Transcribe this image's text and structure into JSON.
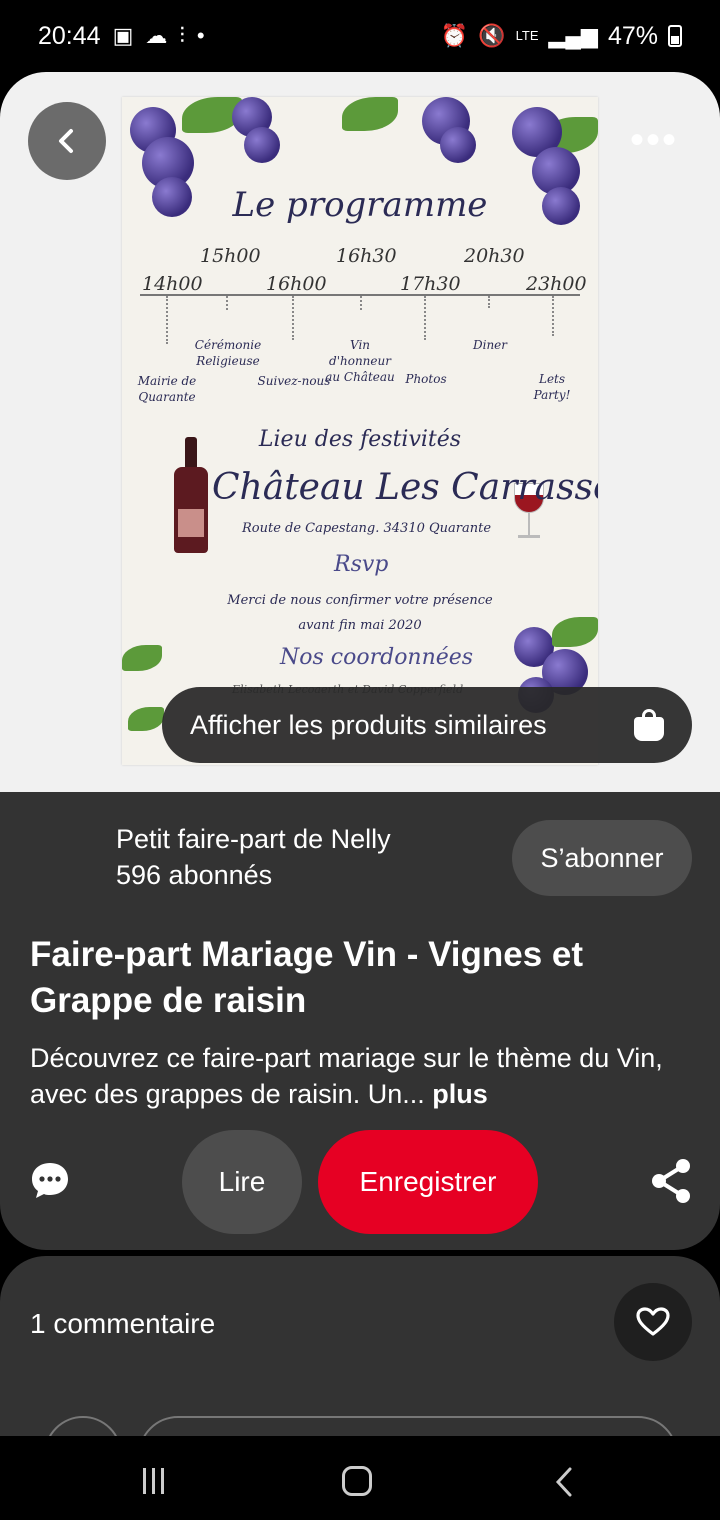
{
  "status_bar": {
    "time": "20:44",
    "network": "LTE",
    "battery": "47%"
  },
  "invitation": {
    "title": "Le programme",
    "times": [
      "14h00",
      "15h00",
      "16h00",
      "16h30",
      "17h30",
      "20h30",
      "23h00"
    ],
    "events": [
      "Mairie de Quarante",
      "Cérémonie Religieuse",
      "Suivez-nous",
      "Vin d'honneur au Château",
      "Photos",
      "Diner",
      "Lets Party!"
    ],
    "lieu_title": "Lieu des festivités",
    "venue": "Château Les Carrasses",
    "address": "Route de Capestang. 34310 Quarante",
    "rsvp": "Rsvp",
    "rsvp_text_1": "Merci de nous confirmer votre présence",
    "rsvp_text_2": "avant fin mai 2020",
    "coords_title": "Nos coordonnées",
    "names": "Elisabeth Lecoaerth et David Copperfield"
  },
  "similar_products_label": "Afficher les produits similaires",
  "creator": {
    "name": "Petit faire-part de Nelly",
    "followers": "596 abonnés",
    "follow_label": "S’abonner"
  },
  "pin": {
    "title": "Faire-part Mariage Vin - Vignes et Grappe de raisin",
    "description": "Découvrez ce faire-part mariage sur le thème du Vin, avec des grappes de raisin. Un...",
    "more_label": "plus"
  },
  "actions": {
    "read_label": "Lire",
    "save_label": "Enregistrer",
    "save_color": "#e60023"
  },
  "comments": {
    "count_label": "1 commentaire"
  },
  "icons": {
    "back": "chevron-left-icon",
    "more": "more-horizontal-icon",
    "bag": "shopping-bag-icon",
    "comment": "comment-bubble-icon",
    "share": "share-icon",
    "like": "heart-icon"
  }
}
